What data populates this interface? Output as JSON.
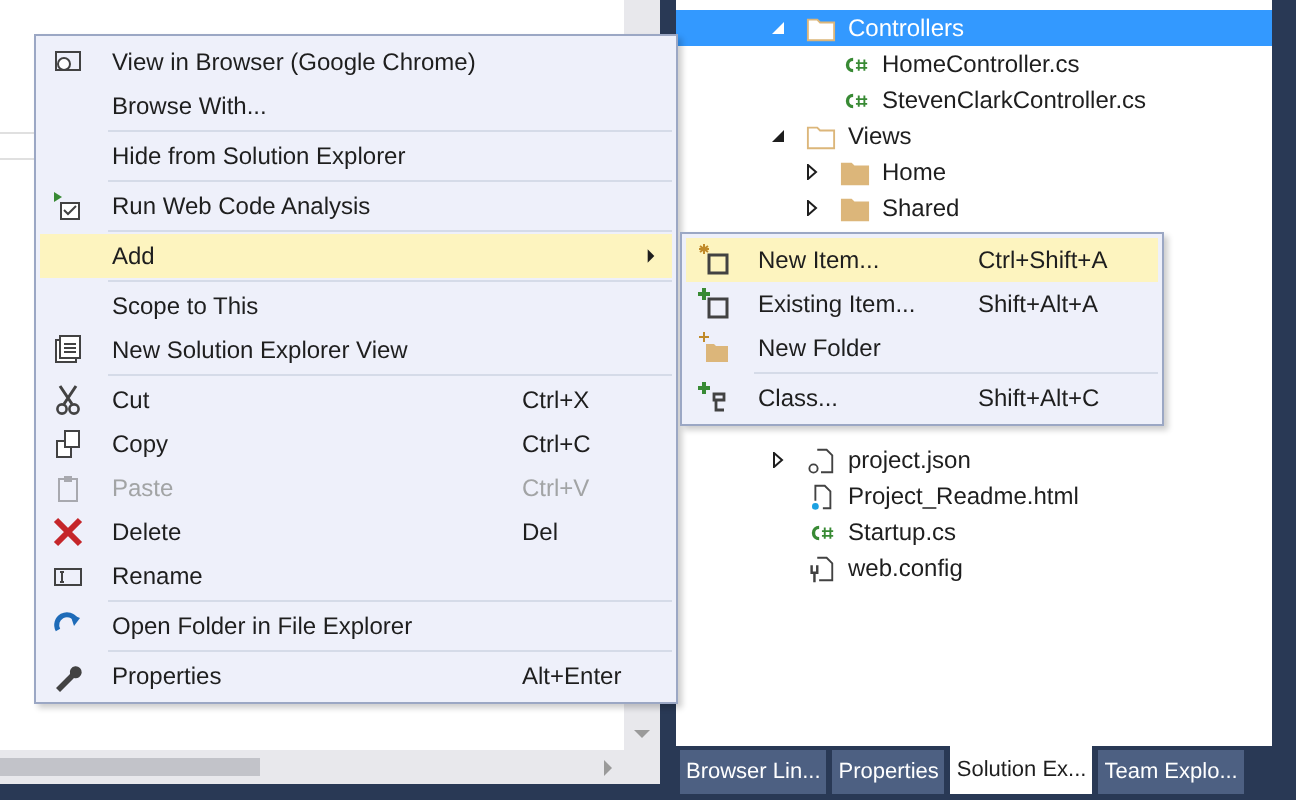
{
  "solution_explorer": {
    "tree": [
      {
        "label": "Controllers",
        "kind": "folder",
        "expanded": true,
        "selected": true,
        "children": [
          {
            "label": "HomeController.cs",
            "kind": "csharp",
            "selected": false
          },
          {
            "label": "StevenClarkController.cs",
            "kind": "csharp",
            "selected": false
          }
        ]
      },
      {
        "label": "Views",
        "kind": "folder",
        "expanded": true,
        "selected": false,
        "children": [
          {
            "label": "Home",
            "kind": "folder",
            "expanded": false,
            "selected": false
          },
          {
            "label": "Shared",
            "kind": "folder",
            "expanded": false,
            "selected": false
          }
        ]
      },
      {
        "label": "project.json",
        "kind": "json",
        "expanded": false,
        "selected": false
      },
      {
        "label": "Project_Readme.html",
        "kind": "html",
        "selected": false
      },
      {
        "label": "Startup.cs",
        "kind": "csharp",
        "selected": false
      },
      {
        "label": "web.config",
        "kind": "config",
        "selected": false
      }
    ],
    "tabs": [
      {
        "label": "Browser Lin...",
        "selected": false
      },
      {
        "label": "Properties",
        "selected": false
      },
      {
        "label": "Solution Ex...",
        "selected": true
      },
      {
        "label": "Team Explo...",
        "selected": false
      }
    ]
  },
  "context_menu": {
    "items": [
      {
        "kind": "item",
        "label": "View in Browser (Google Chrome)",
        "selected": false,
        "disabled": false
      },
      {
        "kind": "item",
        "label": "Browse With...",
        "selected": false,
        "disabled": false
      },
      {
        "kind": "separator"
      },
      {
        "kind": "item",
        "label": "Hide from Solution Explorer",
        "selected": false,
        "disabled": false
      },
      {
        "kind": "separator"
      },
      {
        "kind": "item",
        "label": "Run Web Code Analysis",
        "selected": false,
        "disabled": false
      },
      {
        "kind": "separator"
      },
      {
        "kind": "submenu",
        "label": "Add",
        "selected": true,
        "disabled": false
      },
      {
        "kind": "separator"
      },
      {
        "kind": "item",
        "label": "Scope to This",
        "selected": false,
        "disabled": false
      },
      {
        "kind": "item",
        "label": "New Solution Explorer View",
        "selected": false,
        "disabled": false
      },
      {
        "kind": "separator"
      },
      {
        "kind": "item",
        "label": "Cut",
        "shortcut": "Ctrl+X",
        "selected": false,
        "disabled": false
      },
      {
        "kind": "item",
        "label": "Copy",
        "shortcut": "Ctrl+C",
        "selected": false,
        "disabled": false
      },
      {
        "kind": "item",
        "label": "Paste",
        "shortcut": "Ctrl+V",
        "selected": false,
        "disabled": true
      },
      {
        "kind": "item",
        "label": "Delete",
        "shortcut": "Del",
        "selected": false,
        "disabled": false
      },
      {
        "kind": "item",
        "label": "Rename",
        "selected": false,
        "disabled": false
      },
      {
        "kind": "separator"
      },
      {
        "kind": "item",
        "label": "Open Folder in File Explorer",
        "selected": false,
        "disabled": false
      },
      {
        "kind": "separator"
      },
      {
        "kind": "item",
        "label": "Properties",
        "shortcut": "Alt+Enter",
        "selected": false,
        "disabled": false
      }
    ]
  },
  "submenu": {
    "items": [
      {
        "kind": "item",
        "label": "New Item...",
        "shortcut": "Ctrl+Shift+A",
        "selected": true,
        "disabled": false
      },
      {
        "kind": "item",
        "label": "Existing Item...",
        "shortcut": "Shift+Alt+A",
        "selected": false,
        "disabled": false
      },
      {
        "kind": "item",
        "label": "New Folder",
        "selected": false,
        "disabled": false
      },
      {
        "kind": "separator"
      },
      {
        "kind": "item",
        "label": "Class...",
        "shortcut": "Shift+Alt+C",
        "selected": false,
        "disabled": false
      }
    ]
  }
}
